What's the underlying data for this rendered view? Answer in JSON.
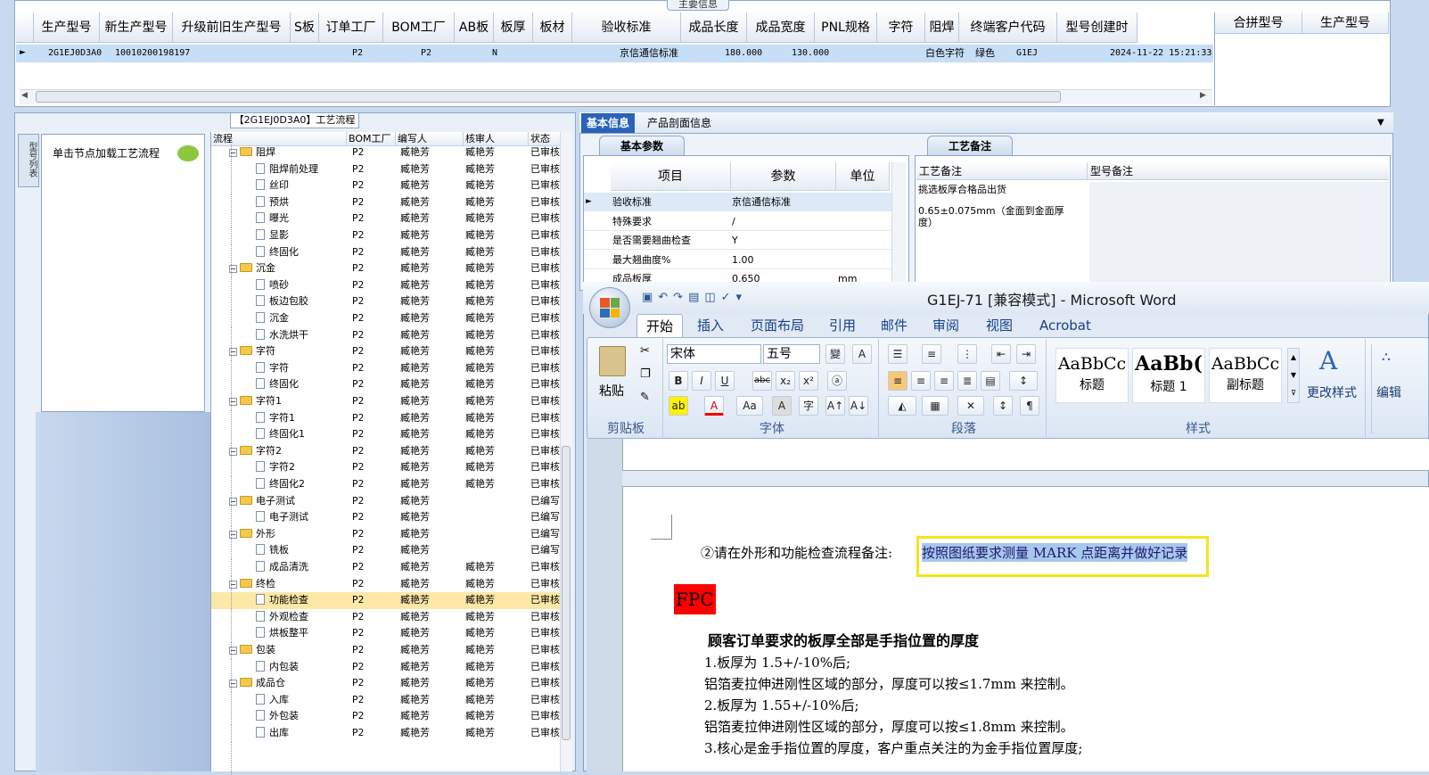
{
  "top": {
    "tab_label": "主要信息",
    "headers": [
      "生产型号",
      "新生产型号",
      "升级前旧生产型号",
      "S板",
      "订单工厂",
      "BOM工厂",
      "AB板",
      "板厚",
      "板材",
      "验收标准",
      "成品长度",
      "成品宽度",
      "PNL规格",
      "字符",
      "阻焊",
      "终端客户代码",
      "型号创建时"
    ],
    "row": {
      "prod_no": "2G1EJ0D3A0",
      "new_no": "10010200198197",
      "order_factory": "P2",
      "bom_factory": "P2",
      "ab": "N",
      "accept": "京信通信标准",
      "length": "180.000",
      "width": "130.000",
      "char": "白色字符",
      "solder": "绿色",
      "customer": "G1EJ",
      "created": "2024-11-22 15:21:33"
    },
    "right_headers": [
      "合拼型号",
      "生产型号"
    ]
  },
  "flow": {
    "title": "【2G1EJ0D3A0】工艺流程",
    "side_tab": "型号列表",
    "node_hint": "单击节点加载工艺流程",
    "columns": [
      "流程",
      "BOM工厂",
      "编写人",
      "核审人",
      "状态"
    ],
    "rows": [
      {
        "t": "folder",
        "name": "阻焊",
        "bom": "P2",
        "w": "臧艳芳",
        "r": "臧艳芳",
        "s": "已审核"
      },
      {
        "t": "doc",
        "name": "阻焊前处理",
        "bom": "P2",
        "w": "臧艳芳",
        "r": "臧艳芳",
        "s": "已审核"
      },
      {
        "t": "doc",
        "name": "丝印",
        "bom": "P2",
        "w": "臧艳芳",
        "r": "臧艳芳",
        "s": "已审核"
      },
      {
        "t": "doc",
        "name": "预烘",
        "bom": "P2",
        "w": "臧艳芳",
        "r": "臧艳芳",
        "s": "已审核"
      },
      {
        "t": "doc",
        "name": "曝光",
        "bom": "P2",
        "w": "臧艳芳",
        "r": "臧艳芳",
        "s": "已审核"
      },
      {
        "t": "doc",
        "name": "显影",
        "bom": "P2",
        "w": "臧艳芳",
        "r": "臧艳芳",
        "s": "已审核"
      },
      {
        "t": "doc",
        "name": "终固化",
        "bom": "P2",
        "w": "臧艳芳",
        "r": "臧艳芳",
        "s": "已审核"
      },
      {
        "t": "folder",
        "name": "沉金",
        "bom": "P2",
        "w": "臧艳芳",
        "r": "臧艳芳",
        "s": "已审核"
      },
      {
        "t": "doc",
        "name": "喷砂",
        "bom": "P2",
        "w": "臧艳芳",
        "r": "臧艳芳",
        "s": "已审核"
      },
      {
        "t": "doc",
        "name": "板边包胶",
        "bom": "P2",
        "w": "臧艳芳",
        "r": "臧艳芳",
        "s": "已审核"
      },
      {
        "t": "doc",
        "name": "沉金",
        "bom": "P2",
        "w": "臧艳芳",
        "r": "臧艳芳",
        "s": "已审核"
      },
      {
        "t": "doc",
        "name": "水洗烘干",
        "bom": "P2",
        "w": "臧艳芳",
        "r": "臧艳芳",
        "s": "已审核"
      },
      {
        "t": "folder",
        "name": "字符",
        "bom": "P2",
        "w": "臧艳芳",
        "r": "臧艳芳",
        "s": "已审核"
      },
      {
        "t": "doc",
        "name": "字符",
        "bom": "P2",
        "w": "臧艳芳",
        "r": "臧艳芳",
        "s": "已审核"
      },
      {
        "t": "doc",
        "name": "终固化",
        "bom": "P2",
        "w": "臧艳芳",
        "r": "臧艳芳",
        "s": "已审核"
      },
      {
        "t": "folder",
        "name": "字符1",
        "bom": "P2",
        "w": "臧艳芳",
        "r": "臧艳芳",
        "s": "已审核"
      },
      {
        "t": "doc",
        "name": "字符1",
        "bom": "P2",
        "w": "臧艳芳",
        "r": "臧艳芳",
        "s": "已审核"
      },
      {
        "t": "doc",
        "name": "终固化1",
        "bom": "P2",
        "w": "臧艳芳",
        "r": "臧艳芳",
        "s": "已审核"
      },
      {
        "t": "folder",
        "name": "字符2",
        "bom": "P2",
        "w": "臧艳芳",
        "r": "臧艳芳",
        "s": "已审核"
      },
      {
        "t": "doc",
        "name": "字符2",
        "bom": "P2",
        "w": "臧艳芳",
        "r": "臧艳芳",
        "s": "已审核"
      },
      {
        "t": "doc",
        "name": "终固化2",
        "bom": "P2",
        "w": "臧艳芳",
        "r": "臧艳芳",
        "s": "已审核"
      },
      {
        "t": "folder",
        "name": "电子测试",
        "bom": "P2",
        "w": "臧艳芳",
        "r": "",
        "s": "已编写"
      },
      {
        "t": "doc",
        "name": "电子测试",
        "bom": "P2",
        "w": "臧艳芳",
        "r": "",
        "s": "已编写"
      },
      {
        "t": "folder",
        "name": "外形",
        "bom": "P2",
        "w": "臧艳芳",
        "r": "",
        "s": "已编写"
      },
      {
        "t": "doc",
        "name": "铣板",
        "bom": "P2",
        "w": "臧艳芳",
        "r": "",
        "s": "已编写"
      },
      {
        "t": "doc",
        "name": "成品清洗",
        "bom": "P2",
        "w": "臧艳芳",
        "r": "臧艳芳",
        "s": "已审核"
      },
      {
        "t": "folder",
        "name": "终检",
        "bom": "P2",
        "w": "臧艳芳",
        "r": "臧艳芳",
        "s": "已审核"
      },
      {
        "t": "doc",
        "name": "功能检查",
        "bom": "P2",
        "w": "臧艳芳",
        "r": "臧艳芳",
        "s": "已审核",
        "sel": true
      },
      {
        "t": "doc",
        "name": "外观检查",
        "bom": "P2",
        "w": "臧艳芳",
        "r": "臧艳芳",
        "s": "已审核"
      },
      {
        "t": "doc",
        "name": "烘板整平",
        "bom": "P2",
        "w": "臧艳芳",
        "r": "臧艳芳",
        "s": "已审核"
      },
      {
        "t": "folder",
        "name": "包装",
        "bom": "P2",
        "w": "臧艳芳",
        "r": "臧艳芳",
        "s": "已审核"
      },
      {
        "t": "doc",
        "name": "内包装",
        "bom": "P2",
        "w": "臧艳芳",
        "r": "臧艳芳",
        "s": "已审核"
      },
      {
        "t": "folder",
        "name": "成品仓",
        "bom": "P2",
        "w": "臧艳芳",
        "r": "臧艳芳",
        "s": "已审核"
      },
      {
        "t": "doc",
        "name": "入库",
        "bom": "P2",
        "w": "臧艳芳",
        "r": "臧艳芳",
        "s": "已审核"
      },
      {
        "t": "doc",
        "name": "外包装",
        "bom": "P2",
        "w": "臧艳芳",
        "r": "臧艳芳",
        "s": "已审核"
      },
      {
        "t": "doc",
        "name": "出库",
        "bom": "P2",
        "w": "臧艳芳",
        "r": "臧艳芳",
        "s": "已审核"
      }
    ]
  },
  "info": {
    "tab_basic": "基本信息",
    "tab_section": "产品剖面信息",
    "sub_basic": "基本参数",
    "sub_note": "工艺备注",
    "param_headers": [
      "项目",
      "参数",
      "单位"
    ],
    "params": [
      {
        "k": "验收标准",
        "v": "京信通信标准",
        "u": ""
      },
      {
        "k": "特殊要求",
        "v": "/",
        "u": ""
      },
      {
        "k": "是否需要翘曲检查",
        "v": "Y",
        "u": ""
      },
      {
        "k": "最大翘曲度%",
        "v": "1.00",
        "u": ""
      },
      {
        "k": "成品板厚",
        "v": "0.650",
        "u": "mm"
      }
    ],
    "note_headers": [
      "工艺备注",
      "型号备注"
    ],
    "note_text1": "挑选板厚合格品出货",
    "note_text2": "0.65±0.075mm（金面到金面厚度）"
  },
  "word": {
    "title": "G1EJ-71 [兼容模式] - Microsoft Word",
    "tabs": [
      "开始",
      "插入",
      "页面布局",
      "引用",
      "邮件",
      "审阅",
      "视图",
      "Acrobat"
    ],
    "font": "宋体",
    "size": "五号",
    "groups": [
      "剪贴板",
      "字体",
      "段落",
      "样式"
    ],
    "paste": "粘贴",
    "styles": [
      {
        "preview": "AaBbCc",
        "name": "标题"
      },
      {
        "preview": "AaBb(",
        "name": "标题 1"
      },
      {
        "preview": "AaBbCc",
        "name": "副标题"
      }
    ],
    "change_style": "更改样式",
    "edit": "编辑",
    "doc": {
      "line1_prefix": "②请在外形和功能检查流程备注:",
      "line1_highlight": "按照图纸要求测量 MARK 点距离并做好记录",
      "fpc": "FPC",
      "heading": "顾客订单要求的板厚全部是手指位置的厚度",
      "lines": [
        "1.板厚为 1.5+/-10%后;",
        "铝箔麦拉伸进刚性区域的部分，厚度可以按≤1.7mm 来控制。",
        "2.板厚为 1.55+/-10%后;",
        "铝箔麦拉伸进刚性区域的部分，厚度可以按≤1.8mm 来控制。",
        "3.核心是金手指位置的厚度，客户重点关注的为金手指位置厚度;"
      ]
    }
  }
}
